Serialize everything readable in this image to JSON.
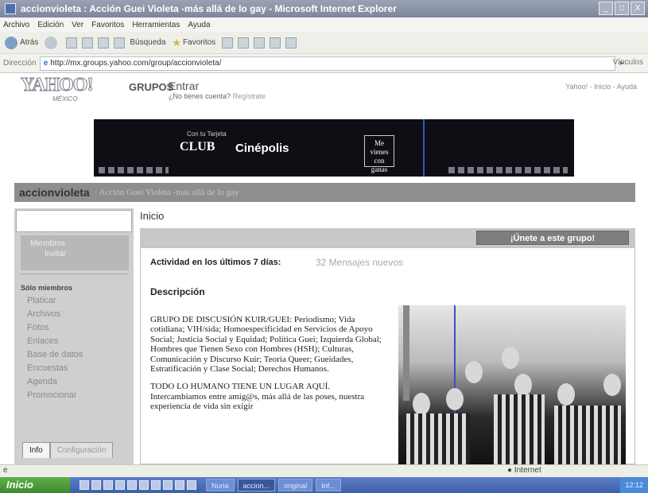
{
  "window": {
    "title": "accionvioleta : Acción Guei Violeta -más allá de lo gay - Microsoft Internet Explorer",
    "buttons": [
      "_",
      "□",
      "X"
    ]
  },
  "menu": [
    "Archivo",
    "Edición",
    "Ver",
    "Favoritos",
    "Herramientas",
    "Ayuda"
  ],
  "toolbar": {
    "back": "Atrás",
    "search": "Búsqueda",
    "favorites": "Favoritos"
  },
  "address": {
    "label": "Dirección",
    "url": "http://mx.groups.yahoo.com/group/accionvioleta/",
    "links": "Vínculos"
  },
  "yahoo": {
    "logo": "YAHOO!",
    "country": "MÉXICO",
    "grupos": "GRUPOS",
    "entrar": "Entrar",
    "no_tienes": "¿No tienes cuenta?",
    "registrate": "Regístrate",
    "toplinks": "Yahoo! - Inicio - Ayuda"
  },
  "banner": {
    "small": "Con tu Tarjeta",
    "club": "CLUB",
    "cinepolis": "Cinépolis",
    "tag_lines": [
      "Me",
      "vienes",
      "con",
      "ganas"
    ]
  },
  "group": {
    "name": "accionvioleta",
    "description": "· Acción Guei Violeta -más allá de lo gay"
  },
  "sidebar": {
    "top_line1": "Miembros",
    "top_line2": "Invitar",
    "members_only": "Sólo miembros",
    "nav": [
      "Platicar",
      "Archivos",
      "Fotos",
      "Enlaces",
      "Base de datos",
      "Encuestas",
      "Agenda",
      "Promocionar"
    ],
    "tabs": [
      "Info",
      "Configuración"
    ]
  },
  "main": {
    "title": "Inicio",
    "join_button": "¡Únete a este grupo!",
    "activity_label": "Actividad en los últimos 7 días:",
    "activity_value": "32 Mensajes nuevos",
    "description_heading": "Descripción",
    "desc_p1": "GRUPO DE DISCUSIÓN KUIR/GUEI: Periodismo; Vida cotidiana; VIH/sida; Homoespecificidad en Servicios de Apoyo Social; Justicia Social y Equidad; Política Guei; Izquierda Global; Hombres que Tienen Sexo con Hombres (HSH); Culturas, Comunicación y Discurso Kuir; Teoría Queer; Gueidades, Estratificación y Clase Social; Derechos Humanos.",
    "desc_p2": "TODO LO HUMANO TIENE UN LUGAR AQUÍ. Intercambiamos entre amig@s, más allá de las poses, nuestra experiencia de vida sin exigir"
  },
  "status": {
    "zone": "Internet"
  },
  "taskbar": {
    "start": "Inicio",
    "tasks": [
      "Nuria",
      "accion...",
      "original",
      "Inf..."
    ],
    "clock": "12:12"
  },
  "colors": {
    "title_bar": "#8a93a8",
    "group_bar": "#8e8e8e",
    "join_button": "#7e7e7e",
    "taskbar": "#4a6db8",
    "start_button": "#4a9a3a"
  }
}
